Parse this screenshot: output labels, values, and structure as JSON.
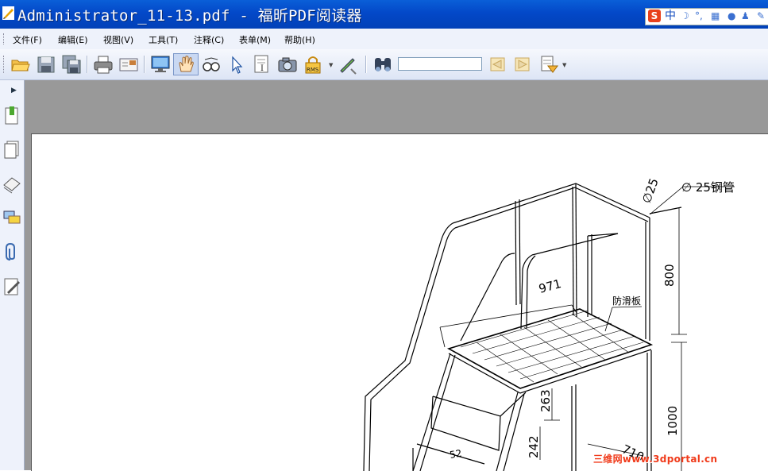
{
  "window": {
    "title": "Administrator_11-13.pdf - 福昕PDF阅读器",
    "app_icon": "foxit-icon",
    "titlebar_color": "#0348c8"
  },
  "ime": {
    "lang": "中",
    "icons": [
      "sogou-icon",
      "moon-icon",
      "punctuation-icon",
      "keyboard-icon",
      "user-icon",
      "shirt-icon",
      "wrench-icon"
    ]
  },
  "menu": {
    "items": [
      "文件(F)",
      "编辑(E)",
      "视图(V)",
      "工具(T)",
      "注释(C)",
      "表单(M)",
      "帮助(H)"
    ]
  },
  "toolbar": {
    "buttons": [
      "open-icon",
      "save-icon",
      "save-all-icon",
      "print-icon",
      "email-icon",
      "fullscreen-icon",
      "hand-icon",
      "zoom-glasses-icon",
      "select-arrow-icon",
      "text-select-icon",
      "snapshot-icon",
      "rms-icon",
      "sign-icon",
      "find-binoculars-icon",
      "prev-result-icon",
      "next-result-icon",
      "highlight-icon"
    ],
    "active_tool": "hand-icon",
    "search_value": "",
    "rms_label": "RMS"
  },
  "sidebar": {
    "buttons": [
      "bookmarks-icon",
      "pages-icon",
      "layers-icon",
      "comments-icon",
      "attachments-icon",
      "signatures-icon"
    ]
  },
  "document": {
    "dimensions": {
      "pipe_diameter": "∅25",
      "pipe_note": "∅ 25钢管",
      "height_upper": "800",
      "height_lower": "1000",
      "platform_depth": "971",
      "step_rise_1": "263",
      "step_rise_2": "242",
      "base_width": "710",
      "step_depth": "52"
    },
    "labels": {
      "antislip": "防滑板"
    }
  },
  "watermark": {
    "text": "三维网www.3dportal.cn",
    "color": "#f03a1a"
  }
}
